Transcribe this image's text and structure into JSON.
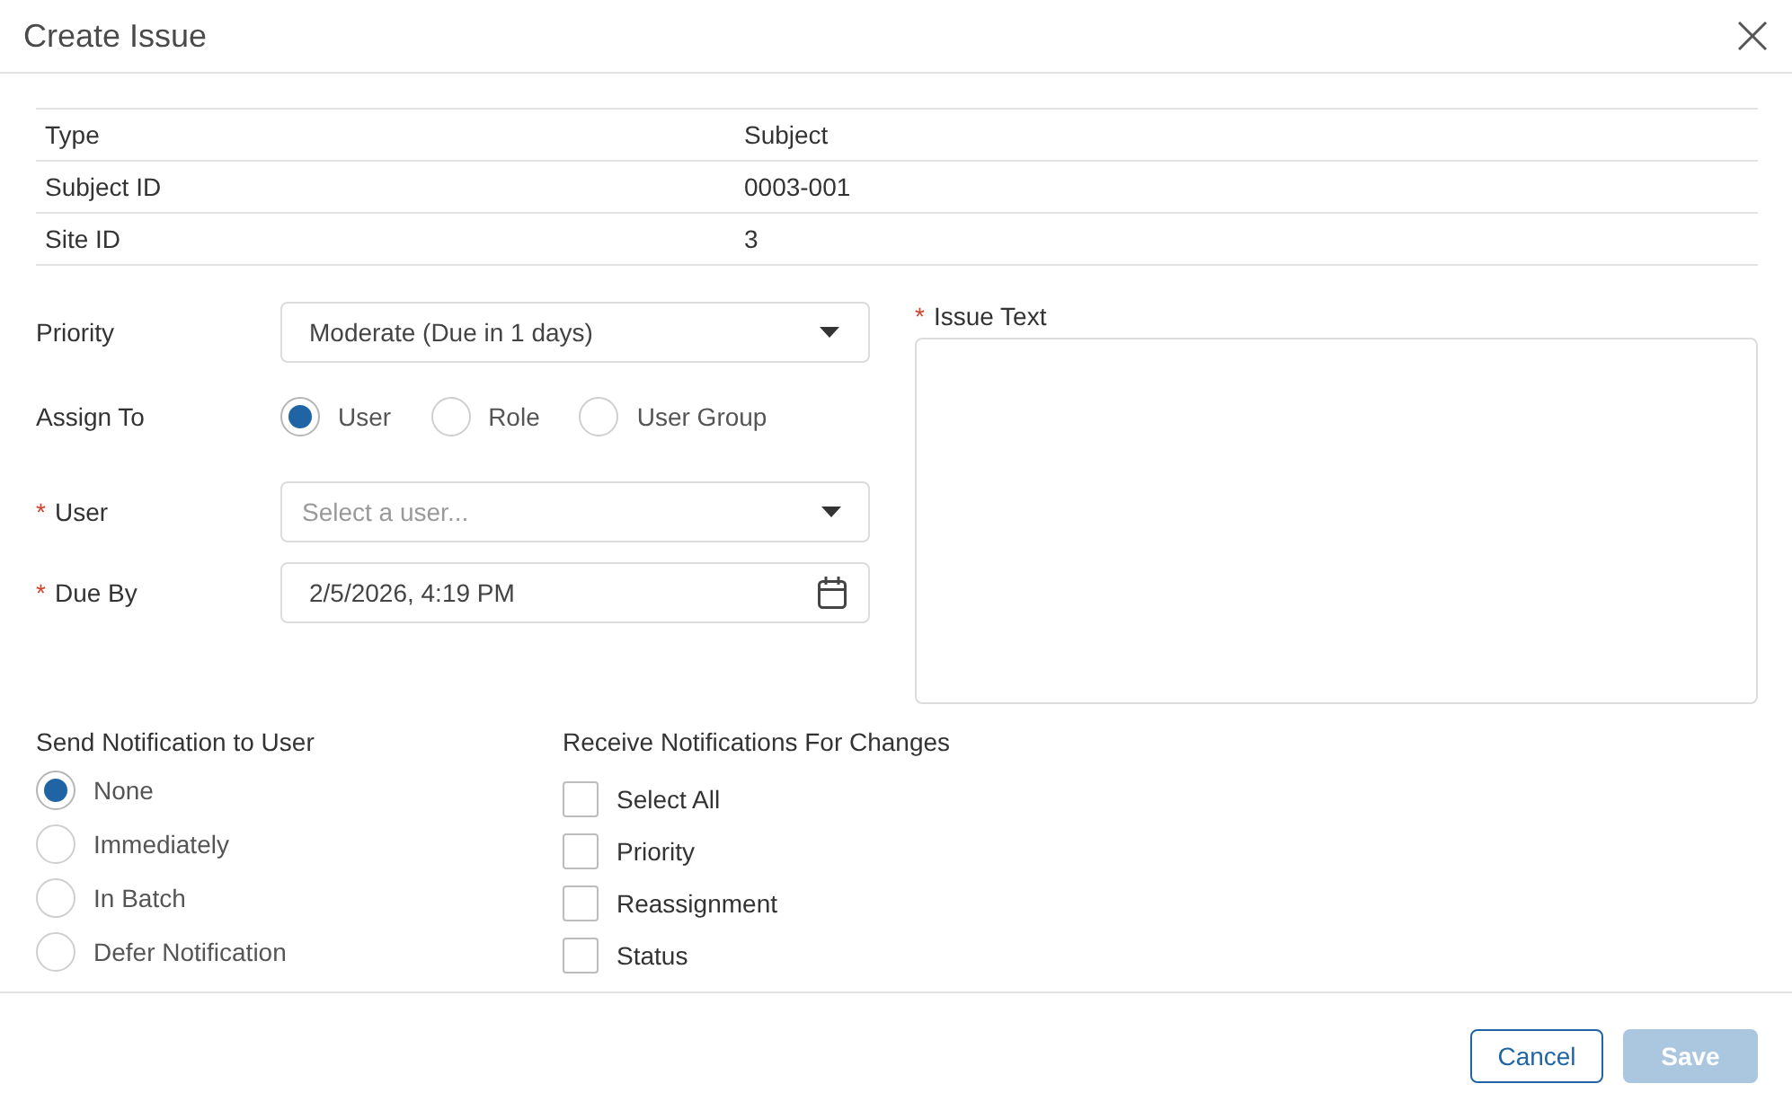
{
  "dialog": {
    "title": "Create Issue"
  },
  "info_table": {
    "rows": [
      {
        "label": "Type",
        "value": "Subject"
      },
      {
        "label": "Subject ID",
        "value": "0003-001"
      },
      {
        "label": "Site ID",
        "value": "3"
      }
    ]
  },
  "form": {
    "priority": {
      "label": "Priority",
      "value": "Moderate (Due in 1 days)"
    },
    "assign_to": {
      "label": "Assign To",
      "options": [
        {
          "label": "User",
          "selected": true
        },
        {
          "label": "Role",
          "selected": false
        },
        {
          "label": "User Group",
          "selected": false
        }
      ]
    },
    "user": {
      "required_mark": "*",
      "label": "User",
      "placeholder": "Select a user..."
    },
    "due_by": {
      "required_mark": "*",
      "label": "Due By",
      "value": "2/5/2026, 4:19 PM"
    },
    "issue_text": {
      "required_mark": "*",
      "label": "Issue Text"
    }
  },
  "send_notification": {
    "label": "Send Notification to User",
    "options": [
      {
        "label": "None",
        "selected": true
      },
      {
        "label": "Immediately",
        "selected": false
      },
      {
        "label": "In Batch",
        "selected": false
      },
      {
        "label": "Defer Notification",
        "selected": false
      }
    ]
  },
  "receive_notifications": {
    "label": "Receive Notifications For Changes",
    "options": [
      {
        "label": "Select All",
        "checked": false
      },
      {
        "label": "Priority",
        "checked": false
      },
      {
        "label": "Reassignment",
        "checked": false
      },
      {
        "label": "Status",
        "checked": false
      }
    ]
  },
  "buttons": [
    {
      "label": "Cancel",
      "kind": "secondary",
      "disabled": false
    },
    {
      "label": "Save",
      "kind": "primary",
      "disabled": true
    }
  ]
}
